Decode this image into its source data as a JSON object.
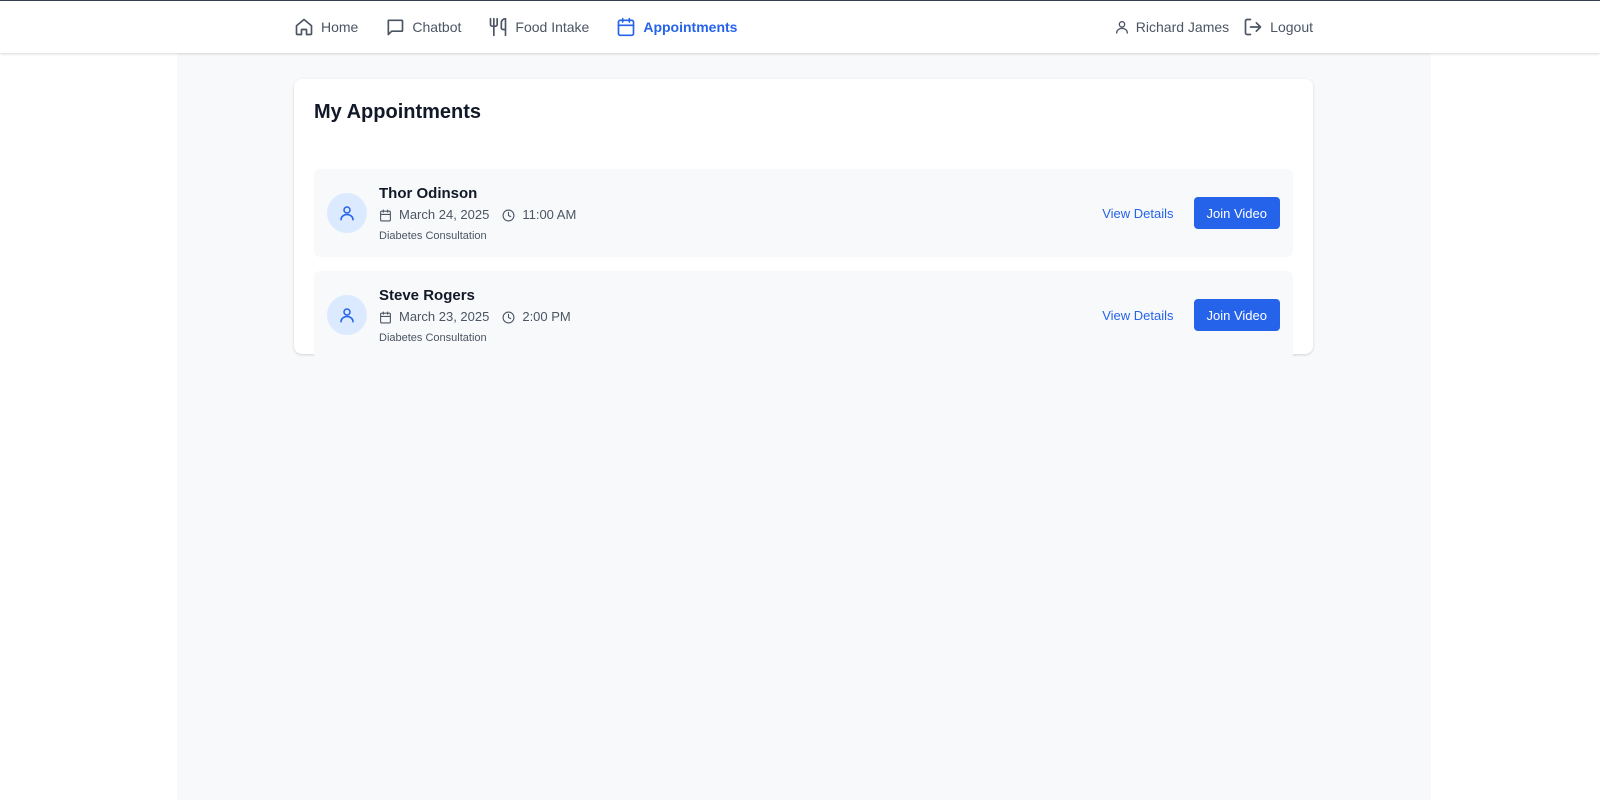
{
  "nav": {
    "items": [
      {
        "label": "Home",
        "icon": "home-icon"
      },
      {
        "label": "Chatbot",
        "icon": "chat-bubble-icon"
      },
      {
        "label": "Food Intake",
        "icon": "utensils-icon"
      },
      {
        "label": "Appointments",
        "icon": "calendar-icon",
        "active": true
      }
    ],
    "user_name": "Richard James",
    "logout_label": "Logout"
  },
  "page": {
    "title": "My Appointments"
  },
  "appointments": [
    {
      "name": "Thor Odinson",
      "date": "March 24, 2025",
      "time": "11:00 AM",
      "type": "Diabetes Consultation",
      "view_label": "View Details",
      "join_label": "Join Video"
    },
    {
      "name": "Steve Rogers",
      "date": "March 23, 2025",
      "time": "2:00 PM",
      "type": "Diabetes Consultation",
      "view_label": "View Details",
      "join_label": "Join Video"
    }
  ],
  "colors": {
    "accent": "#2563eb",
    "avatar_bg": "#dbeafe",
    "page_bg": "#f8f9fb"
  }
}
